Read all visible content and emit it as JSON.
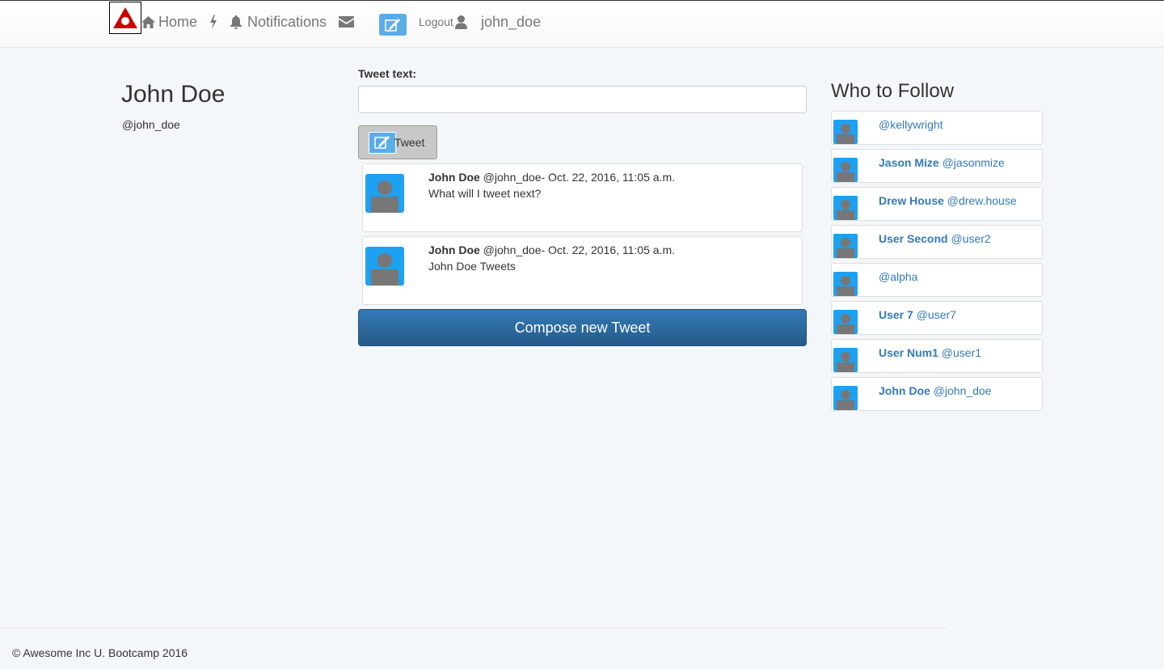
{
  "colors": {
    "brand_red": "#cc0000",
    "avatar_blue": "#1da1f2",
    "compose_blue": "#337ab7",
    "link_blue": "#337ab7"
  },
  "nav": {
    "logo_icon": "triangle-logo-icon",
    "home_label": "Home",
    "notifications_label": "Notifications",
    "logout_label": "Logout",
    "username": "john_doe"
  },
  "profile": {
    "name": "John Doe",
    "handle": "@john_doe"
  },
  "composer": {
    "label": "Tweet text:",
    "value": "",
    "placeholder": "",
    "button_label": "Tweet"
  },
  "tweets": [
    {
      "author": "John Doe",
      "meta": " @john_doe- Oct. 22, 2016, 11:05 a.m.",
      "text": "What will I tweet next?"
    },
    {
      "author": "John Doe",
      "meta": " @john_doe- Oct. 22, 2016, 11:05 a.m.",
      "text": "John Doe Tweets"
    }
  ],
  "compose_new_label": "Compose new Tweet",
  "who_to_follow": {
    "title": "Who to Follow",
    "users": [
      {
        "name": "",
        "handle": "@kellywright"
      },
      {
        "name": "Jason Mize",
        "handle": " @jasonmize"
      },
      {
        "name": "Drew House",
        "handle": " @drew.house"
      },
      {
        "name": "User Second",
        "handle": " @user2"
      },
      {
        "name": "",
        "handle": "@alpha"
      },
      {
        "name": "User 7",
        "handle": " @user7"
      },
      {
        "name": "User Num1",
        "handle": " @user1"
      },
      {
        "name": "John Doe",
        "handle": " @john_doe"
      }
    ]
  },
  "footer": {
    "text": "© Awesome Inc U. Bootcamp 2016"
  }
}
